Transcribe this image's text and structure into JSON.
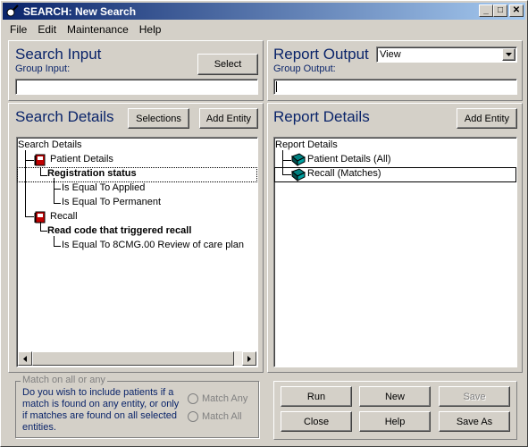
{
  "window": {
    "title": "SEARCH: New Search",
    "minimize": "_",
    "maximize": "□",
    "close": "✕"
  },
  "menu": [
    "File",
    "Edit",
    "Maintenance",
    "Help"
  ],
  "search_input": {
    "heading": "Search Input",
    "group_label": "Group Input:",
    "select_button": "Select",
    "value": ""
  },
  "report_output": {
    "heading": "Report Output",
    "dropdown_value": "View",
    "group_label": "Group Output:",
    "value": ""
  },
  "search_details": {
    "heading": "Search Details",
    "selections_button": "Selections",
    "add_entity_button": "Add Entity",
    "root": "Search Details",
    "items": [
      {
        "text": "Patient Details",
        "type": "entity"
      },
      {
        "text": "Registration status",
        "type": "criterion"
      },
      {
        "text": "Is Equal To Applied",
        "type": "value"
      },
      {
        "text": "Is Equal To Permanent",
        "type": "value"
      },
      {
        "text": "Recall",
        "type": "entity"
      },
      {
        "text": "Read code that triggered recall",
        "type": "criterion"
      },
      {
        "text": "Is Equal To 8CMG.00 Review of care plan",
        "type": "value"
      }
    ]
  },
  "report_details": {
    "heading": "Report Details",
    "add_entity_button": "Add Entity",
    "root": "Report Details",
    "items": [
      {
        "text": "Patient Details (All)"
      },
      {
        "text": "Recall (Matches)"
      }
    ]
  },
  "match_group": {
    "legend": "Match on all or any",
    "question": "Do you wish to include patients if a match is found on any entity, or only if matches are found on all selected entities.",
    "options": [
      "Match Any",
      "Match All"
    ]
  },
  "actions": {
    "run": "Run",
    "new": "New",
    "save": "Save",
    "close": "Close",
    "help": "Help",
    "save_as": "Save As"
  },
  "colors": {
    "heading": "#0a246a",
    "title_start": "#0a246a",
    "title_end": "#a6caf0",
    "face": "#d4d0c8"
  }
}
